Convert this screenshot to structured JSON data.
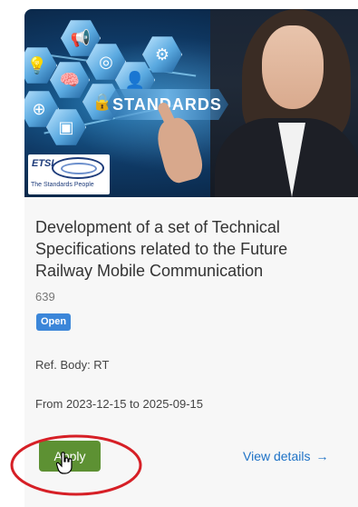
{
  "card": {
    "image": {
      "banner_text": "STANDARDS",
      "logo_text": "ETSI",
      "logo_tagline": "The Standards People"
    },
    "title": "Development of a set of Technical Specifications related to the Future Railway Mobile Communication",
    "number": "639",
    "status_badge": "Open",
    "ref_body": "Ref. Body: RT",
    "dates": "From 2023-12-15 to 2025-09-15",
    "apply_label": "Apply",
    "view_details_label": "View details",
    "view_details_arrow": "→"
  },
  "colors": {
    "apply_button": "#5d9133",
    "badge": "#3b86d9",
    "link": "#1e72c6",
    "highlight_circle": "#d61f26",
    "card_background": "#f7f7f7"
  },
  "icons": [
    "megaphone-icon",
    "lightbulb-icon",
    "brain-icon",
    "target-icon",
    "gear-icon",
    "user-gear-icon",
    "lock-icon",
    "www-icon",
    "chip-icon",
    "hand-cursor-icon",
    "arrow-right-icon"
  ]
}
